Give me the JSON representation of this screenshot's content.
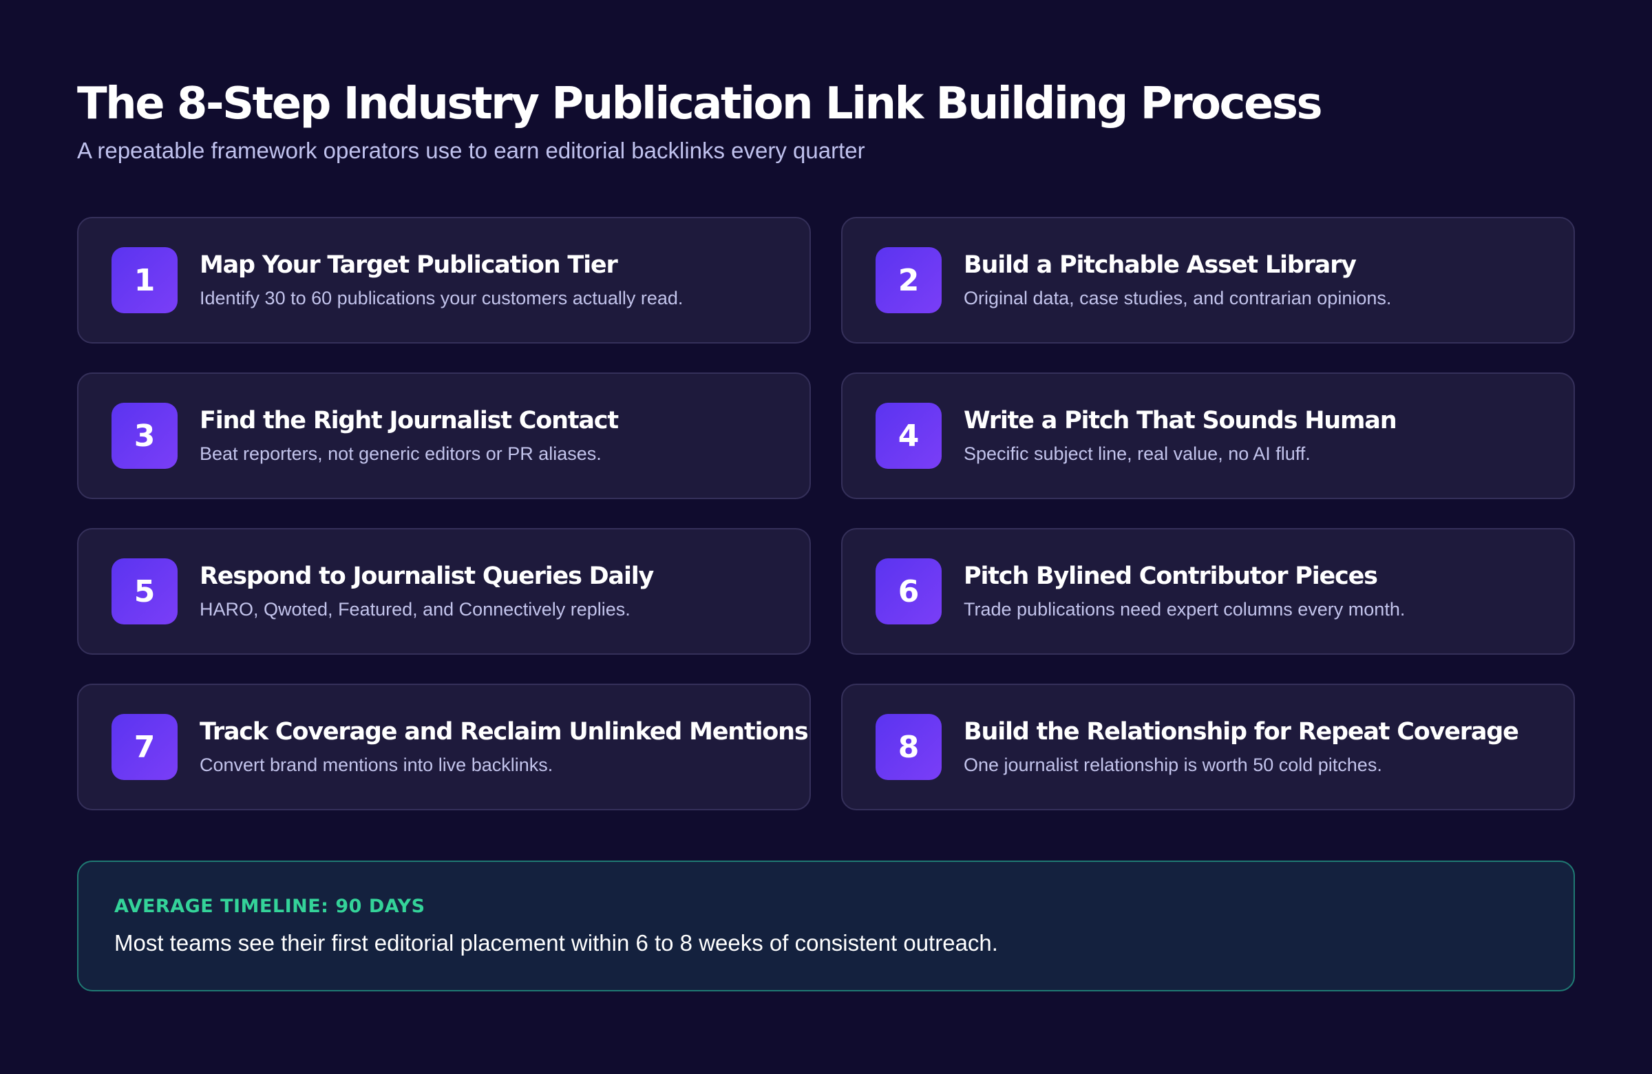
{
  "header": {
    "title": "The 8-Step Industry Publication Link Building Process",
    "subtitle": "A repeatable framework operators use to earn editorial backlinks every quarter"
  },
  "steps": [
    {
      "number": "1",
      "title": "Map Your Target Publication Tier",
      "description": "Identify 30 to 60 publications your customers actually read."
    },
    {
      "number": "2",
      "title": "Build a Pitchable Asset Library",
      "description": "Original data, case studies, and contrarian opinions."
    },
    {
      "number": "3",
      "title": "Find the Right Journalist Contact",
      "description": "Beat reporters, not generic editors or PR aliases."
    },
    {
      "number": "4",
      "title": "Write a Pitch That Sounds Human",
      "description": "Specific subject line, real value, no AI fluff."
    },
    {
      "number": "5",
      "title": "Respond to Journalist Queries Daily",
      "description": "HARO, Qwoted, Featured, and Connectively replies."
    },
    {
      "number": "6",
      "title": "Pitch Bylined Contributor Pieces",
      "description": "Trade publications need expert columns every month."
    },
    {
      "number": "7",
      "title": "Track Coverage and Reclaim Unlinked Mentions",
      "description": "Convert brand mentions into live backlinks."
    },
    {
      "number": "8",
      "title": "Build the Relationship for Repeat Coverage",
      "description": "One journalist relationship is worth 50 cold pitches."
    }
  ],
  "timeline": {
    "label": "AVERAGE TIMELINE: 90 DAYS",
    "text": "Most teams see their first editorial placement within 6 to 8 weeks of consistent outreach."
  },
  "colors": {
    "background": "#100c2e",
    "card_background": "#1e1a3c",
    "badge_accent": "#6a3af5",
    "timeline_accent": "#34d399"
  }
}
